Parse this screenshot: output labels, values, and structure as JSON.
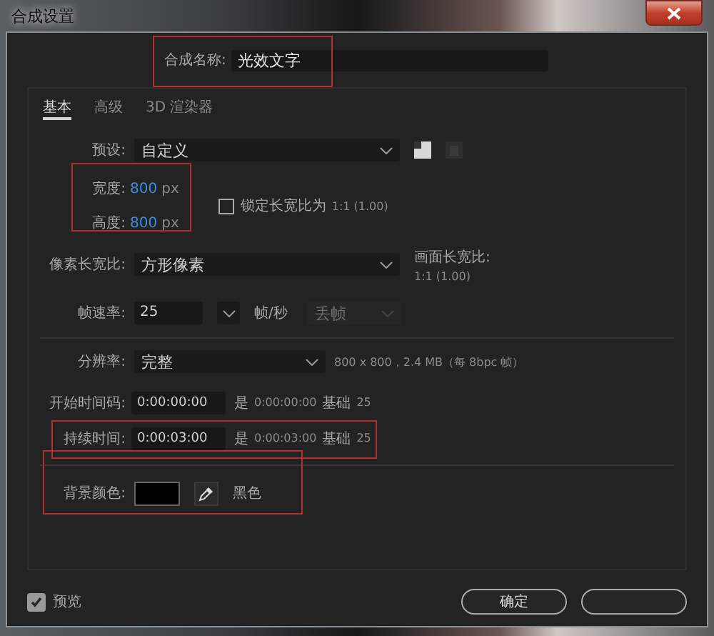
{
  "window": {
    "title": "合成设置"
  },
  "composition_name": {
    "label": "合成名称:",
    "value": "光效文字",
    "highlighted": true
  },
  "tabs": [
    {
      "label": "基本",
      "selected": true
    },
    {
      "label": "高级",
      "selected": false
    },
    {
      "label": "3D 渲染器",
      "selected": false
    }
  ],
  "preset": {
    "label": "预设:",
    "value": "自定义"
  },
  "size": {
    "highlighted": true,
    "width": {
      "label": "宽度:",
      "value": "800",
      "unit": "px"
    },
    "height": {
      "label": "高度:",
      "value": "800",
      "unit": "px"
    }
  },
  "lock_aspect": {
    "label": "锁定长宽比为",
    "ratio": "1:1 (1.00)",
    "checked": false
  },
  "pixel_aspect": {
    "label": "像素长宽比:",
    "value": "方形像素"
  },
  "frame_aspect": {
    "label": "画面长宽比:",
    "value": "1:1 (1.00)"
  },
  "frame_rate": {
    "label": "帧速率:",
    "value": "25",
    "unit": "帧/秒",
    "drop_frame": {
      "value": "丢帧",
      "disabled": true
    }
  },
  "resolution": {
    "label": "分辨率:",
    "value": "完整",
    "info": "800 x 800，2.4 MB（每 8bpc 帧）"
  },
  "start_timecode": {
    "label": "开始时间码:",
    "value": "0:00:00:00",
    "is": "是",
    "equivalent": "0:00:00:00",
    "base_label": "基础",
    "base": "25",
    "highlighted": false
  },
  "duration": {
    "label": "持续时间:",
    "value": "0:00:03:00",
    "is": "是",
    "equivalent": "0:00:03:00",
    "base_label": "基础",
    "base": "25",
    "highlighted": true
  },
  "background": {
    "label": "背景颜色:",
    "color": "#000000",
    "name": "黑色",
    "highlighted": true
  },
  "preview": {
    "label": "预览",
    "checked": true
  },
  "buttons": [
    {
      "kind": "text",
      "label": "确定"
    },
    {
      "kind": "blank"
    }
  ]
}
